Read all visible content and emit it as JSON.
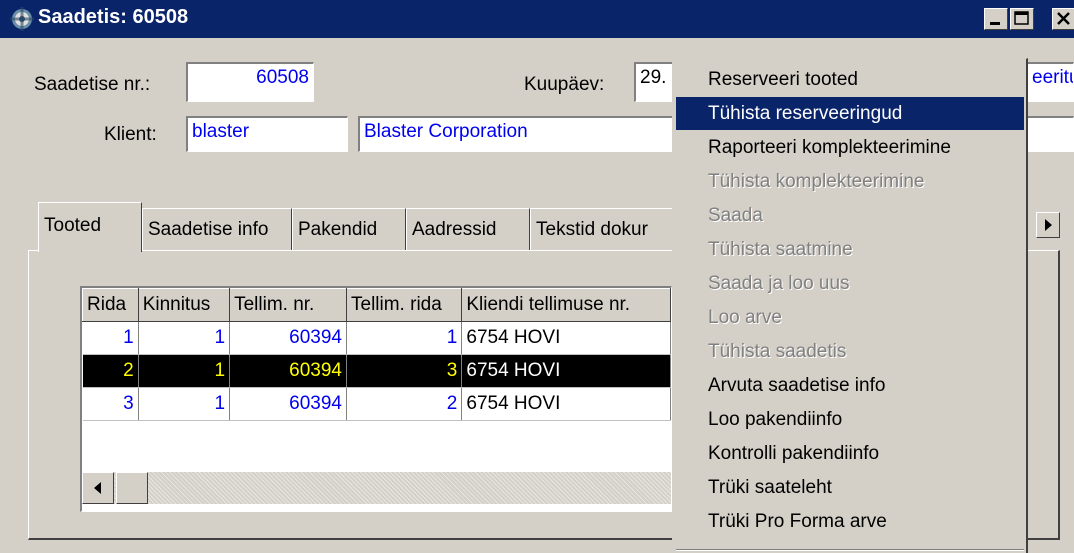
{
  "window": {
    "title": "Saadetis: 60508",
    "minimize": "_",
    "maximize": "□",
    "close": "X"
  },
  "form": {
    "shipment_label": "Saadetise nr.:",
    "shipment_value": "60508",
    "date_label": "Kuupäev:",
    "date_value": "29.",
    "status_value": "eeritu",
    "client_label": "Klient:",
    "client_code": "blaster",
    "client_name": "Blaster Corporation"
  },
  "tabs": [
    "Tooted",
    "Saadetise info",
    "Pakendid",
    "Aadressid",
    "Tekstid dokur"
  ],
  "grid": {
    "columns": [
      "Rida",
      "Kinnitus",
      "Tellim. nr.",
      "Tellim. rida",
      "Kliendi tellimuse nr."
    ],
    "rows": [
      [
        "1",
        "1",
        "60394",
        "1",
        "6754 HOVI"
      ],
      [
        "2",
        "1",
        "60394",
        "3",
        "6754 HOVI"
      ],
      [
        "3",
        "1",
        "60394",
        "2",
        "6754 HOVI"
      ]
    ],
    "selected_row_index": 1
  },
  "menu": {
    "items": [
      {
        "label": "Reserveeri tooted",
        "state": "enabled"
      },
      {
        "label": "Tühista reserveeringud",
        "state": "highlighted"
      },
      {
        "label": "Raporteeri komplekteerimine",
        "state": "enabled"
      },
      {
        "label": "Tühista komplekteerimine",
        "state": "disabled"
      },
      {
        "label": "Saada",
        "state": "disabled"
      },
      {
        "label": "Tühista saatmine",
        "state": "disabled"
      },
      {
        "label": "Saada ja loo uus",
        "state": "disabled"
      },
      {
        "label": "Loo arve",
        "state": "disabled"
      },
      {
        "label": "Tühista saadetis",
        "state": "disabled"
      },
      {
        "label": "Arvuta saadetise info",
        "state": "enabled"
      },
      {
        "label": "Loo pakendiinfo",
        "state": "enabled"
      },
      {
        "label": "Kontrolli pakendiinfo",
        "state": "enabled"
      },
      {
        "label": "Trüki saateleht",
        "state": "enabled"
      },
      {
        "label": "Trüki Pro Forma arve",
        "state": "enabled"
      }
    ]
  },
  "colors": {
    "titlebar": "#0a246a",
    "face": "#d4d0c8",
    "value_text": "#0000ee",
    "selection_bg": "#000000",
    "selection_num": "#ffff00"
  },
  "icons": {
    "app": "app-gear-icon",
    "tab_scroll": "arrow-right-icon",
    "scroll_left": "arrow-left-icon"
  }
}
